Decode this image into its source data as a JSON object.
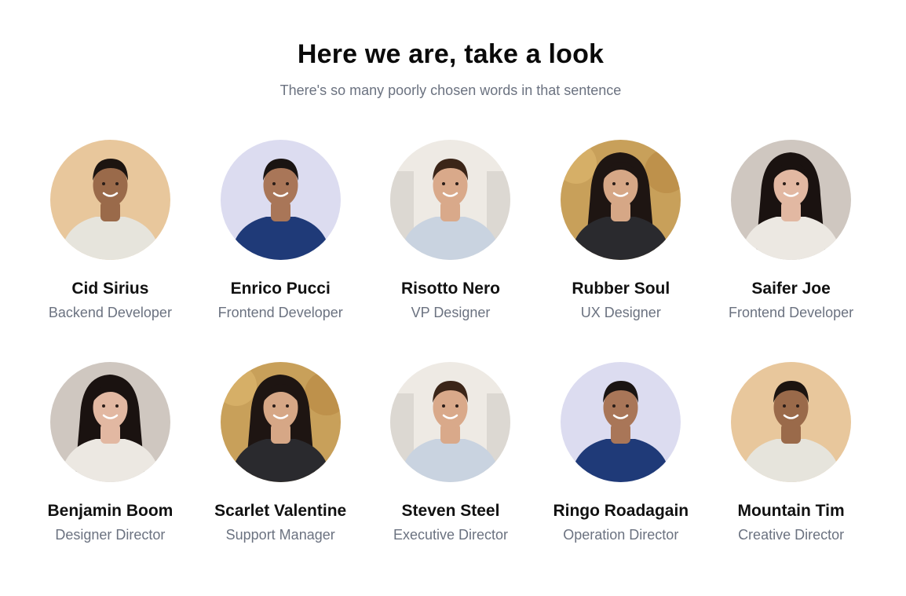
{
  "header": {
    "title": "Here we are, take a look",
    "subtitle": "There's so many poorly chosen words in that sentence"
  },
  "members": [
    {
      "name": "Cid Sirius",
      "role": "Backend Developer",
      "photo": "young-man-tan-bg",
      "bg": "#e8c79c",
      "skin": "#9a6a4a",
      "hair": "#1c1410",
      "shirt": "#e6e4dc"
    },
    {
      "name": "Enrico Pucci",
      "role": "Frontend Developer",
      "photo": "man-blue-suit",
      "bg": "#dcdcf0",
      "skin": "#a97658",
      "hair": "#1a1412",
      "shirt": "#1f3a78"
    },
    {
      "name": "Risotto Nero",
      "role": "VP Designer",
      "photo": "man-office",
      "bg": "#eeeae4",
      "skin": "#d9a98a",
      "hair": "#3b2518",
      "shirt": "#c9d3e0"
    },
    {
      "name": "Rubber Soul",
      "role": "UX Designer",
      "photo": "woman-autumn",
      "bg": "#c8a05a",
      "skin": "#d6a786",
      "hair": "#1e1512",
      "shirt": "#2a2a2e"
    },
    {
      "name": "Saifer Joe",
      "role": "Frontend Developer",
      "photo": "woman-long-hair",
      "bg": "#cfc7c0",
      "skin": "#e2b8a2",
      "hair": "#1a1210",
      "shirt": "#ece8e2"
    },
    {
      "name": "Benjamin Boom",
      "role": "Designer Director",
      "photo": "woman-long-hair",
      "bg": "#cfc7c0",
      "skin": "#e2b8a2",
      "hair": "#1a1210",
      "shirt": "#ece8e2"
    },
    {
      "name": "Scarlet Valentine",
      "role": "Support Manager",
      "photo": "woman-autumn",
      "bg": "#c8a05a",
      "skin": "#d6a786",
      "hair": "#1e1512",
      "shirt": "#2a2a2e"
    },
    {
      "name": "Steven Steel",
      "role": "Executive Director",
      "photo": "man-office",
      "bg": "#eeeae4",
      "skin": "#d9a98a",
      "hair": "#3b2518",
      "shirt": "#c9d3e0"
    },
    {
      "name": "Ringo Roadagain",
      "role": "Operation Director",
      "photo": "man-blue-suit",
      "bg": "#dcdcf0",
      "skin": "#a97658",
      "hair": "#1a1412",
      "shirt": "#1f3a78"
    },
    {
      "name": "Mountain Tim",
      "role": "Creative Director",
      "photo": "young-man-tan-bg",
      "bg": "#e8c79c",
      "skin": "#9a6a4a",
      "hair": "#1c1410",
      "shirt": "#e6e4dc"
    }
  ]
}
